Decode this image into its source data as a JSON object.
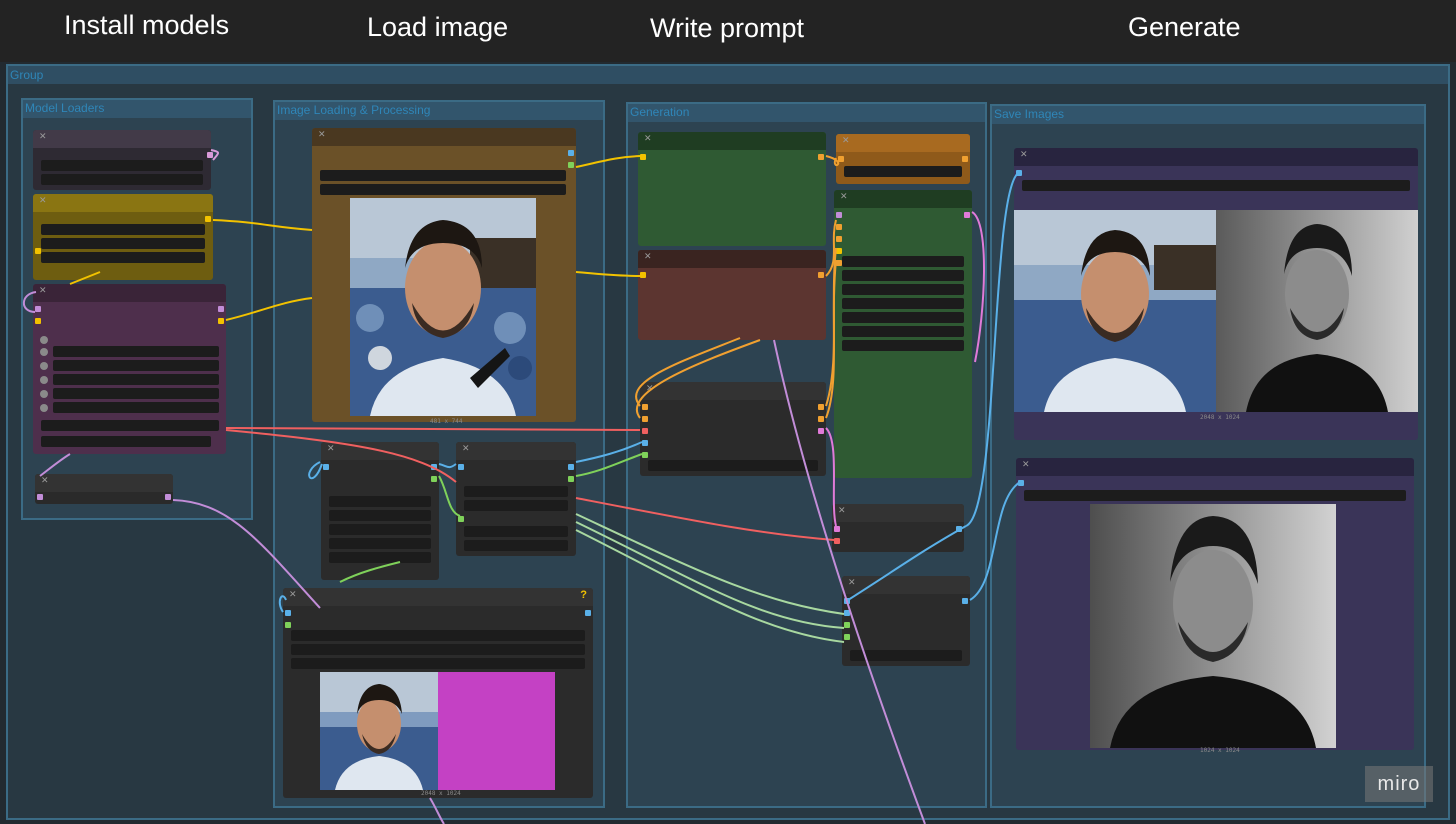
{
  "steps": [
    "Install models",
    "Load image",
    "Write prompt",
    "Generate"
  ],
  "groups": {
    "outer": "Group",
    "model_loaders": "Model Loaders",
    "image_loading": "Image Loading & Processing",
    "generation": "Generation",
    "save_images": "Save Images"
  },
  "captions": {
    "load_image": "481 x 744",
    "preview_main": "2048 x 1024",
    "compare": "2048 x 1024",
    "final": "1024 x 1024"
  },
  "warning_badge": "?",
  "watermark": "miro",
  "colors": {
    "canvas": "#222a30",
    "group_border": "#3b6b85",
    "group_title": "#2f86b8",
    "node_yellow": "#7a6a1a",
    "node_brown": "#6e5530",
    "node_purple": "#5a3558",
    "node_green": "#2f5a33",
    "node_red": "#5c3530",
    "node_orange": "#8f5a1a",
    "node_navy": "#3a3458",
    "magenta_mask": "#c441c4"
  }
}
